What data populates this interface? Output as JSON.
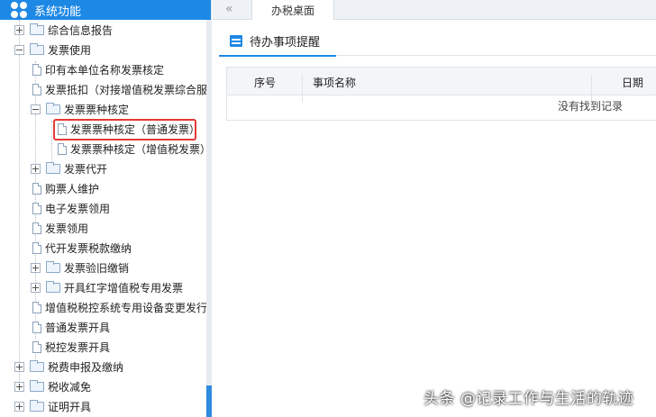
{
  "sidebar": {
    "title": "系统功能",
    "items": [
      {
        "label": "综合信息报告"
      },
      {
        "label": "发票使用"
      },
      {
        "label": "印有本单位名称发票核定"
      },
      {
        "label": "发票抵扣（对接增值税发票综合服"
      },
      {
        "label": "发票票种核定"
      },
      {
        "label": "发票票种核定（普通发票）"
      },
      {
        "label": "发票票种核定（增值税发票）"
      },
      {
        "label": "发票代开"
      },
      {
        "label": "购票人维护"
      },
      {
        "label": "电子发票领用"
      },
      {
        "label": "发票领用"
      },
      {
        "label": "代开发票税款缴纳"
      },
      {
        "label": "发票验旧缴销"
      },
      {
        "label": "开具红字增值税专用发票"
      },
      {
        "label": "增值税税控系统专用设备变更发行"
      },
      {
        "label": "普通发票开具"
      },
      {
        "label": "税控发票开具"
      },
      {
        "label": "税费申报及缴纳"
      },
      {
        "label": "税收减免"
      },
      {
        "label": "证明开具"
      }
    ]
  },
  "topbar": {
    "collapse_symbol": "«",
    "tab_label": "办税桌面"
  },
  "main": {
    "section_title": "待办事项提醒",
    "columns": [
      "序号",
      "事项名称",
      "日期"
    ],
    "empty_text": "没有找到记录"
  },
  "watermark": "头条 @记录工作与生活的轨迹",
  "colors": {
    "accent": "#1e88e5",
    "highlight": "#e53935"
  }
}
